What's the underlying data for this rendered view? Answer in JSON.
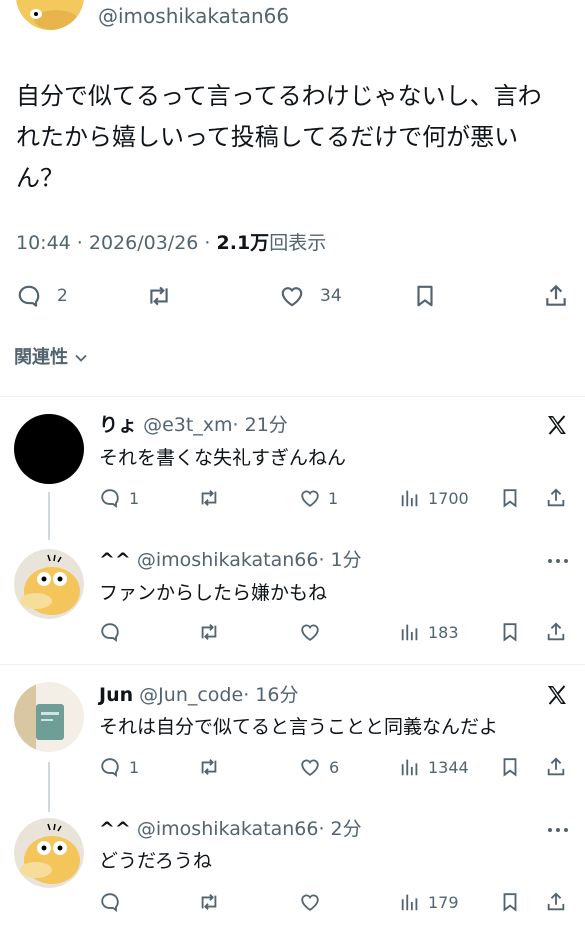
{
  "main_tweet": {
    "handle": "@imoshikakatan66",
    "text_line1": "自分で似てるって言ってるわけじゃないし、言わ",
    "text_line2": "れたから嬉しいって投稿してるだけで何が悪い",
    "text_line3": "ん？",
    "time": "10:44 · 2026/03/26 · ",
    "views_count": "2.1万",
    "views_label": "回表示",
    "actions": {
      "replies": "2",
      "likes": "34"
    }
  },
  "relevance": {
    "label": "関連性"
  },
  "replies": [
    {
      "name": "りょ",
      "handle": "@e3t_xm",
      "time": "· 21分",
      "text": "それを書くな失礼すぎんねん",
      "replies": "1",
      "retweets": "",
      "likes": "1",
      "views": "1700"
    },
    {
      "name": "^^",
      "handle": "@imoshikakatan66",
      "time": "· 1分",
      "text": "ファンからしたら嫌かもね",
      "replies": "",
      "retweets": "",
      "likes": "",
      "views": "183"
    },
    {
      "name": "Jun",
      "handle": "@Jun_code",
      "time": "· 16分",
      "text": "それは自分で似てると言うことと同義なんだよ",
      "replies": "1",
      "retweets": "",
      "likes": "6",
      "views": "1344"
    },
    {
      "name": "^^",
      "handle": "@imoshikakatan66",
      "time": "· 2分",
      "text": "どうだろうね",
      "replies": "",
      "retweets": "",
      "likes": "",
      "views": "179"
    }
  ],
  "colors": {
    "text": "#0f1419",
    "secondary": "#536471",
    "divider": "#eff3f4",
    "thread": "#cfd9de"
  },
  "icons": [
    "reply-icon",
    "retweet-icon",
    "like-icon",
    "bookmark-icon",
    "share-icon",
    "views-icon",
    "x-logo-icon",
    "more-icon"
  ]
}
